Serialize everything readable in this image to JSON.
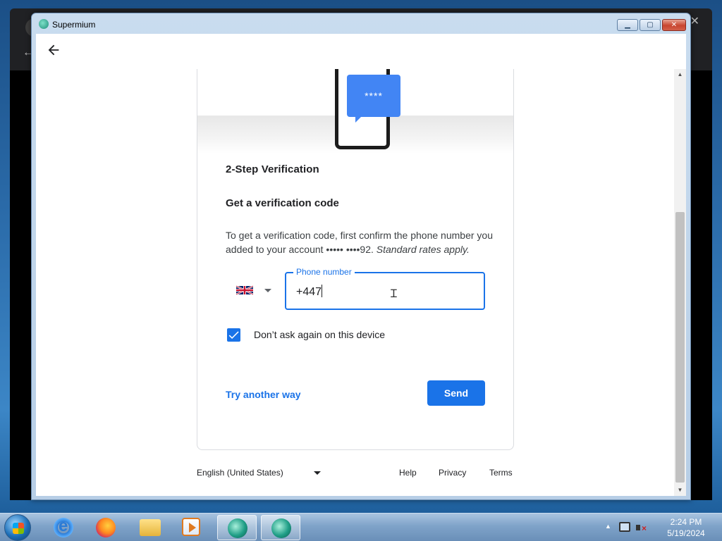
{
  "window": {
    "title": "Supermium",
    "controls": {
      "minimize": "▁",
      "maximize": "▢",
      "close": "✕"
    }
  },
  "page": {
    "illustration_code": "****",
    "step_title": "2-Step Verification",
    "heading": "Get a verification code",
    "description": "To get a verification code, first confirm the phone number you added to your account ••••• ••••92. ",
    "description_emphasis": "Standard rates apply.",
    "phone_field": {
      "label": "Phone number",
      "value": "+447"
    },
    "country": {
      "flag_icon": "uk-flag-icon"
    },
    "checkbox": {
      "label": "Don’t ask again on this device",
      "checked": true
    },
    "try_another_way": "Try another way",
    "send_button": "Send"
  },
  "footer": {
    "language": "English (United States)",
    "help": "Help",
    "privacy": "Privacy",
    "terms": "Terms"
  },
  "taskbar": {
    "clock_time": "2:24 PM",
    "clock_date": "5/19/2024"
  },
  "colors": {
    "accent": "#1a73e8",
    "illustration_blue": "#4285f4"
  }
}
